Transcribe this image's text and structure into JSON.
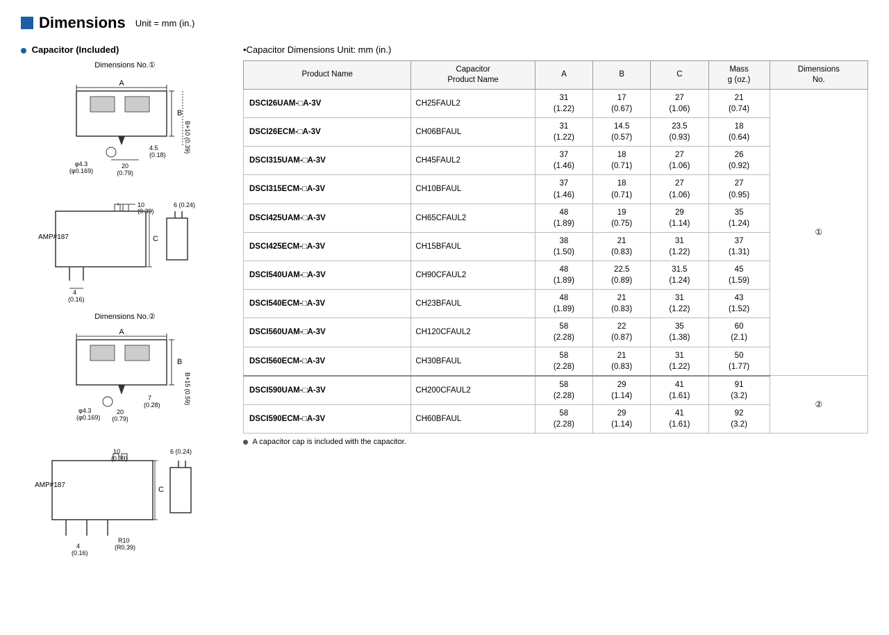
{
  "header": {
    "title": "Dimensions",
    "unit": "Unit = mm (in.)"
  },
  "left": {
    "section_title": "Capacitor (Included)",
    "dim1_label": "Dimensions No.①",
    "dim2_label": "Dimensions No.②"
  },
  "right": {
    "table_title": "•Capacitor Dimensions   Unit: mm (in.)",
    "columns": {
      "product_name": "Product Name",
      "cap_product": "Capacitor Product Name",
      "a": "A",
      "b": "B",
      "c": "C",
      "mass": "Mass g (oz.)",
      "dim_no": "Dimensions No."
    },
    "rows": [
      {
        "product": "DSCI26UAM-□A-3V",
        "cap": "CH25FAUL2",
        "a": "31\n(1.22)",
        "b": "17\n(0.67)",
        "c": "27\n(1.06)",
        "mass": "21\n(0.74)",
        "dim": "①",
        "dim_span": 10
      },
      {
        "product": "DSCI26ECM-□A-3V",
        "cap": "CH06BFAUL",
        "a": "31\n(1.22)",
        "b": "14.5\n(0.57)",
        "c": "23.5\n(0.93)",
        "mass": "18\n(0.64)",
        "dim": ""
      },
      {
        "product": "DSCI315UAM-□A-3V",
        "cap": "CH45FAUL2",
        "a": "37\n(1.46)",
        "b": "18\n(0.71)",
        "c": "27\n(1.06)",
        "mass": "26\n(0.92)",
        "dim": ""
      },
      {
        "product": "DSCI315ECM-□A-3V",
        "cap": "CH10BFAUL",
        "a": "37\n(1.46)",
        "b": "18\n(0.71)",
        "c": "27\n(1.06)",
        "mass": "27\n(0.95)",
        "dim": ""
      },
      {
        "product": "DSCI425UAM-□A-3V",
        "cap": "CH65CFAUL2",
        "a": "48\n(1.89)",
        "b": "19\n(0.75)",
        "c": "29\n(1.14)",
        "mass": "35\n(1.24)",
        "dim": ""
      },
      {
        "product": "DSCI425ECM-□A-3V",
        "cap": "CH15BFAUL",
        "a": "38\n(1.50)",
        "b": "21\n(0.83)",
        "c": "31\n(1.22)",
        "mass": "37\n(1.31)",
        "dim": ""
      },
      {
        "product": "DSCI540UAM-□A-3V",
        "cap": "CH90CFAUL2",
        "a": "48\n(1.89)",
        "b": "22.5\n(0.89)",
        "c": "31.5\n(1.24)",
        "mass": "45\n(1.59)",
        "dim": ""
      },
      {
        "product": "DSCI540ECM-□A-3V",
        "cap": "CH23BFAUL",
        "a": "48\n(1.89)",
        "b": "21\n(0.83)",
        "c": "31\n(1.22)",
        "mass": "43\n(1.52)",
        "dim": ""
      },
      {
        "product": "DSCI560UAM-□A-3V",
        "cap": "CH120CFAUL2",
        "a": "58\n(2.28)",
        "b": "22\n(0.87)",
        "c": "35\n(1.38)",
        "mass": "60\n(2.1)",
        "dim": ""
      },
      {
        "product": "DSCI560ECM-□A-3V",
        "cap": "CH30BFAUL",
        "a": "58\n(2.28)",
        "b": "21\n(0.83)",
        "c": "31\n(1.22)",
        "mass": "50\n(1.77)",
        "dim": "",
        "group_end": true
      },
      {
        "product": "DSCI590UAM-□A-3V",
        "cap": "CH200CFAUL2",
        "a": "58\n(2.28)",
        "b": "29\n(1.14)",
        "c": "41\n(1.61)",
        "mass": "91\n(3.2)",
        "dim": "②",
        "dim_span": 2
      },
      {
        "product": "DSCI590ECM-□A-3V",
        "cap": "CH60BFAUL",
        "a": "58\n(2.28)",
        "b": "29\n(1.14)",
        "c": "41\n(1.61)",
        "mass": "92\n(3.2)",
        "dim": ""
      }
    ],
    "footnote": "A capacitor cap is included with the capacitor."
  }
}
